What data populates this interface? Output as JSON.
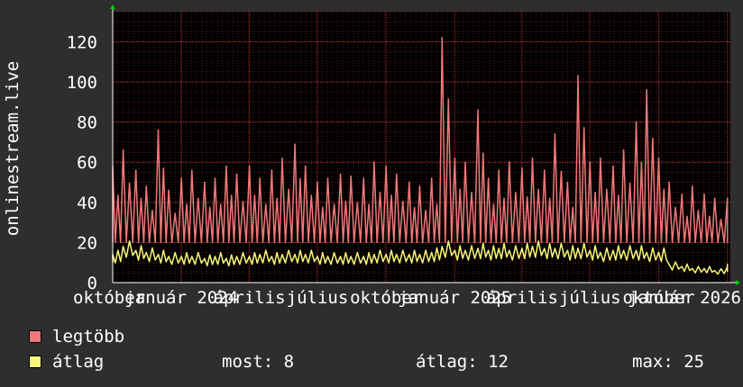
{
  "chart_data": {
    "type": "line",
    "ylabel": "onlinestream.live",
    "ylim": [
      0,
      135
    ],
    "yticks": [
      0,
      20,
      40,
      60,
      80,
      100,
      120
    ],
    "xlim": [
      "2023-10-01",
      "2026-01-05"
    ],
    "xtick_labels": [
      {
        "text": "október",
        "date": "2023-10-01"
      },
      {
        "text": "január 2024",
        "date": "2024-01-01"
      },
      {
        "text": "április",
        "date": "2024-04-01"
      },
      {
        "text": "július",
        "date": "2024-07-01"
      },
      {
        "text": "október",
        "date": "2024-10-01"
      },
      {
        "text": "január 2025",
        "date": "2025-01-01"
      },
      {
        "text": "április",
        "date": "2025-04-01"
      },
      {
        "text": "július",
        "date": "2025-07-01"
      },
      {
        "text": "október",
        "date": "2025-10-01"
      },
      {
        "text": "január 2026",
        "date": "2026-01-01"
      }
    ],
    "grid": true,
    "background": "#000000",
    "grid_color": "#8b2a2a",
    "series": [
      {
        "name": "legtöbb",
        "color": "#f07878",
        "x": [
          "2023-10-01",
          "2023-10-15",
          "2023-11-01",
          "2023-11-15",
          "2023-12-01",
          "2023-12-15",
          "2024-01-01",
          "2024-01-15",
          "2024-02-01",
          "2024-02-15",
          "2024-03-01",
          "2024-03-15",
          "2024-04-01",
          "2024-04-15",
          "2024-05-01",
          "2024-05-15",
          "2024-06-01",
          "2024-06-15",
          "2024-07-01",
          "2024-07-15",
          "2024-08-01",
          "2024-08-15",
          "2024-09-01",
          "2024-09-15",
          "2024-10-01",
          "2024-10-15",
          "2024-11-01",
          "2024-11-15",
          "2024-12-01",
          "2024-12-15",
          "2025-01-01",
          "2025-01-15",
          "2025-02-01",
          "2025-02-15",
          "2025-03-01",
          "2025-03-15",
          "2025-04-01",
          "2025-04-15",
          "2025-05-01",
          "2025-05-15",
          "2025-06-01",
          "2025-06-15",
          "2025-07-01",
          "2025-07-15",
          "2025-08-01",
          "2025-08-15",
          "2025-09-01",
          "2025-09-15",
          "2025-10-01",
          "2025-10-15",
          "2025-11-01",
          "2025-11-15",
          "2025-12-01",
          "2025-12-15",
          "2026-01-01"
        ],
        "values": [
          58,
          66,
          56,
          48,
          76,
          46,
          52,
          56,
          50,
          52,
          58,
          54,
          58,
          52,
          56,
          62,
          69,
          58,
          50,
          52,
          54,
          53,
          52,
          60,
          58,
          54,
          50,
          48,
          52,
          122,
          62,
          60,
          86,
          52,
          56,
          60,
          57,
          62,
          56,
          74,
          50,
          103,
          60,
          62,
          58,
          66,
          80,
          96,
          62,
          50,
          44,
          48,
          44,
          42,
          42
        ]
      },
      {
        "name": "átlag",
        "color": "#f8f878",
        "x": [
          "2023-10-01",
          "2023-10-15",
          "2023-11-01",
          "2023-11-15",
          "2023-12-01",
          "2023-12-15",
          "2024-01-01",
          "2024-01-15",
          "2024-02-01",
          "2024-02-15",
          "2024-03-01",
          "2024-03-15",
          "2024-04-01",
          "2024-04-15",
          "2024-05-01",
          "2024-05-15",
          "2024-06-01",
          "2024-06-15",
          "2024-07-01",
          "2024-07-15",
          "2024-08-01",
          "2024-08-15",
          "2024-09-01",
          "2024-09-15",
          "2024-10-01",
          "2024-10-15",
          "2024-11-01",
          "2024-11-15",
          "2024-12-01",
          "2024-12-15",
          "2025-01-01",
          "2025-01-15",
          "2025-02-01",
          "2025-02-15",
          "2025-03-01",
          "2025-03-15",
          "2025-04-01",
          "2025-04-15",
          "2025-05-01",
          "2025-05-15",
          "2025-06-01",
          "2025-06-15",
          "2025-07-01",
          "2025-07-15",
          "2025-08-01",
          "2025-08-15",
          "2025-09-01",
          "2025-09-15",
          "2025-10-01",
          "2025-10-15",
          "2025-11-01",
          "2025-11-15",
          "2025-12-01",
          "2025-12-15",
          "2026-01-01"
        ],
        "values": [
          14,
          18,
          16,
          15,
          14,
          13,
          13,
          13,
          12,
          13,
          12,
          13,
          13,
          14,
          13,
          14,
          14,
          14,
          13,
          13,
          13,
          13,
          13,
          14,
          14,
          14,
          14,
          14,
          15,
          18,
          16,
          16,
          17,
          16,
          17,
          16,
          17,
          18,
          17,
          17,
          16,
          17,
          16,
          15,
          16,
          16,
          16,
          15,
          15,
          9,
          8,
          7,
          7,
          6,
          8
        ]
      }
    ]
  },
  "legend": [
    {
      "label": "legtöbb",
      "color": "#f07878"
    },
    {
      "label": "átlag",
      "color": "#f8f878"
    }
  ],
  "stats": {
    "most": "most: 8",
    "atlag": "átlag: 12",
    "max": "max: 25"
  }
}
